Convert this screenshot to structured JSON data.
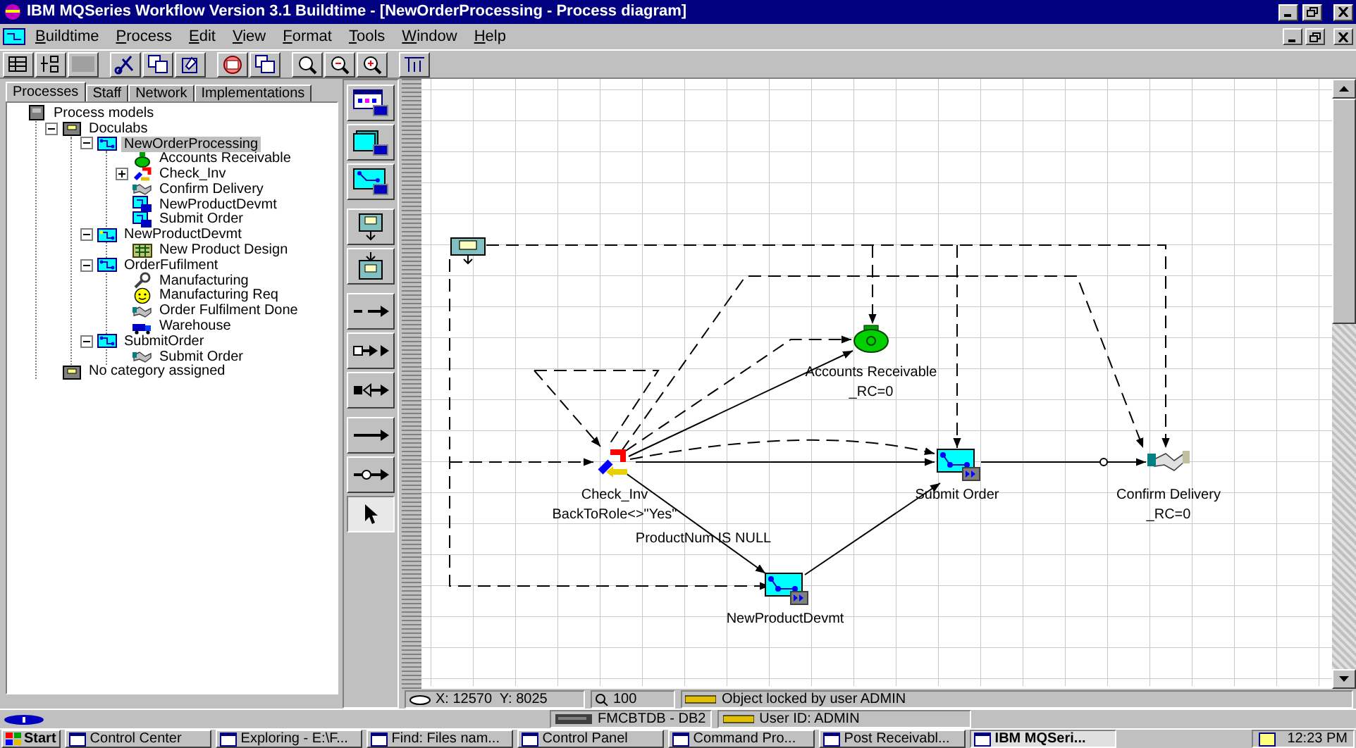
{
  "window": {
    "title": "IBM MQSeries Workflow Version 3.1 Buildtime - [NewOrderProcessing - Process diagram]"
  },
  "menu": [
    "Buildtime",
    "Process",
    "Edit",
    "View",
    "Format",
    "Tools",
    "Window",
    "Help"
  ],
  "tabs": [
    {
      "label": "Processes",
      "selected": true
    },
    {
      "label": "Staff",
      "selected": false
    },
    {
      "label": "Network",
      "selected": false
    },
    {
      "label": "Implementations",
      "selected": false
    }
  ],
  "tree": [
    {
      "label": "Process models",
      "kind": "models",
      "selected": false,
      "children": [
        {
          "label": "Doculabs",
          "kind": "category",
          "selected": false,
          "expanded": true,
          "children": [
            {
              "label": "NewOrderProcessing",
              "kind": "process",
              "selected": true,
              "expanded": true,
              "children": [
                {
                  "label": "Accounts Receivable",
                  "kind": "bag",
                  "selected": false
                },
                {
                  "label": "Check_Inv",
                  "kind": "loop",
                  "selected": false,
                  "expanded": false
                },
                {
                  "label": "Confirm Delivery",
                  "kind": "handshake",
                  "selected": false
                },
                {
                  "label": "NewProductDevmt",
                  "kind": "subprocess",
                  "selected": false
                },
                {
                  "label": "Submit Order",
                  "kind": "subprocess",
                  "selected": false
                }
              ]
            },
            {
              "label": "NewProductDevmt",
              "kind": "process-yellow",
              "selected": false,
              "expanded": true,
              "children": [
                {
                  "label": "New Product Design",
                  "kind": "design",
                  "selected": false
                }
              ]
            },
            {
              "label": "OrderFufilment",
              "kind": "process",
              "selected": false,
              "expanded": true,
              "children": [
                {
                  "label": "Manufacturing",
                  "kind": "wrench",
                  "selected": false
                },
                {
                  "label": "Manufacturing Req",
                  "kind": "smiley",
                  "selected": false
                },
                {
                  "label": "Order Fulfilment Done",
                  "kind": "handshake",
                  "selected": false
                },
                {
                  "label": "Warehouse",
                  "kind": "truck",
                  "selected": false
                }
              ]
            },
            {
              "label": "SubmitOrder",
              "kind": "process",
              "selected": false,
              "expanded": true,
              "children": [
                {
                  "label": "Submit Order",
                  "kind": "handshake",
                  "selected": false
                }
              ]
            }
          ]
        },
        {
          "label": "No category assigned",
          "kind": "category",
          "selected": false
        }
      ]
    }
  ],
  "palette": [
    {
      "kind": "program",
      "selected": false
    },
    {
      "kind": "process",
      "selected": false
    },
    {
      "kind": "block",
      "selected": false
    },
    {
      "kind": "source",
      "selected": false
    },
    {
      "kind": "sink",
      "selected": false
    },
    {
      "kind": "control-connector",
      "selected": false
    },
    {
      "kind": "data-connector",
      "selected": false
    },
    {
      "kind": "default-data-connector",
      "selected": false
    },
    {
      "kind": "solid-connector",
      "selected": false
    },
    {
      "kind": "default-connector",
      "selected": false
    },
    {
      "kind": "pointer",
      "selected": true
    }
  ],
  "diagram": {
    "nodes": [
      {
        "kind": "source"
      },
      {
        "kind": "bag",
        "label": "Accounts Receivable",
        "condition": "_RC=0"
      },
      {
        "kind": "loop",
        "label": "Check_Inv",
        "condition": "BackToRole<>\"Yes\""
      },
      {
        "kind": "process",
        "label": "NewProductDevmt"
      },
      {
        "kind": "process",
        "label": "Submit Order"
      },
      {
        "kind": "handshake",
        "label": "Confirm Delivery",
        "condition": "_RC=0"
      }
    ],
    "connector_labels": [
      "ProductNum IS NULL"
    ]
  },
  "canvas_status": {
    "position": "X: 12570  Y: 8025",
    "zoom": "100",
    "lock": "Object locked by user ADMIN"
  },
  "status_bar": {
    "database": "FMCBTDB - DB2",
    "user": "User ID: ADMIN"
  },
  "taskbar": {
    "start": "Start",
    "clock": "12:23 PM",
    "tasks": [
      {
        "label": "Control Center",
        "selected": false
      },
      {
        "label": "Exploring - E:\\F...",
        "selected": false
      },
      {
        "label": "Find: Files nam...",
        "selected": false
      },
      {
        "label": "Control Panel",
        "selected": false
      },
      {
        "label": "Command Pro...",
        "selected": false
      },
      {
        "label": "Post Receivabl...",
        "selected": false
      },
      {
        "label": "IBM MQSeri...",
        "selected": true
      }
    ]
  }
}
